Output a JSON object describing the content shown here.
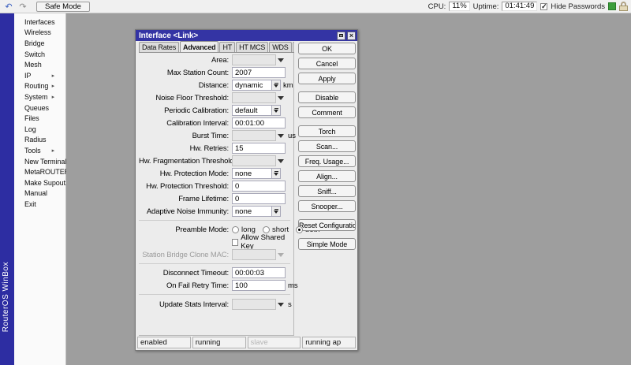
{
  "colors": {
    "titlebar_blue": "#3434a4",
    "brand_strip_blue": "#2d2da2",
    "canvas_gray": "#9e9e9e",
    "status_icon_green": "#3c9e3c"
  },
  "icons": {
    "undo": "↶",
    "redo": "↷",
    "close": "×",
    "submenu_arrow": "▸",
    "check": "✓"
  },
  "toolbar": {
    "safe_mode_label": "Safe Mode",
    "cpu_label": "CPU:",
    "cpu_value": "11%",
    "uptime_label": "Uptime:",
    "uptime_value": "01:41:49",
    "hide_passwords_label": "Hide Passwords",
    "hide_passwords_checked": true
  },
  "sidebar": {
    "brand": "RouterOS WinBox",
    "items": [
      {
        "label": "Interfaces",
        "submenu": false
      },
      {
        "label": "Wireless",
        "submenu": false
      },
      {
        "label": "Bridge",
        "submenu": false
      },
      {
        "label": "Switch",
        "submenu": false
      },
      {
        "label": "Mesh",
        "submenu": false
      },
      {
        "label": "IP",
        "submenu": true
      },
      {
        "label": "Routing",
        "submenu": true
      },
      {
        "label": "System",
        "submenu": true
      },
      {
        "label": "Queues",
        "submenu": false
      },
      {
        "label": "Files",
        "submenu": false
      },
      {
        "label": "Log",
        "submenu": false
      },
      {
        "label": "Radius",
        "submenu": false
      },
      {
        "label": "Tools",
        "submenu": true
      },
      {
        "label": "New Terminal",
        "submenu": false
      },
      {
        "label": "MetaROUTER",
        "submenu": false
      },
      {
        "label": "Make Supout.rif",
        "submenu": false
      },
      {
        "label": "Manual",
        "submenu": false
      },
      {
        "label": "Exit",
        "submenu": false
      }
    ]
  },
  "dialog": {
    "title": "Interface <Link>",
    "tabs": [
      "Data Rates",
      "Advanced",
      "HT",
      "HT MCS",
      "WDS",
      "..."
    ],
    "active_tab": "Advanced",
    "form": {
      "area": {
        "label": "Area:",
        "value": ""
      },
      "max_station_count": {
        "label": "Max Station Count:",
        "value": "2007"
      },
      "distance": {
        "label": "Distance:",
        "value": "dynamic",
        "unit": "km"
      },
      "noise_floor_threshold": {
        "label": "Noise Floor Threshold:",
        "value": ""
      },
      "periodic_calibration": {
        "label": "Periodic Calibration:",
        "value": "default"
      },
      "calibration_interval": {
        "label": "Calibration Interval:",
        "value": "00:01:00"
      },
      "burst_time": {
        "label": "Burst Time:",
        "value": "",
        "unit": "us"
      },
      "hw_retries": {
        "label": "Hw. Retries:",
        "value": "15"
      },
      "hw_fragmentation_threshold": {
        "label": "Hw. Fragmentation Threshold:",
        "value": ""
      },
      "hw_protection_mode": {
        "label": "Hw. Protection Mode:",
        "value": "none"
      },
      "hw_protection_threshold": {
        "label": "Hw. Protection Threshold:",
        "value": "0"
      },
      "frame_lifetime": {
        "label": "Frame Lifetime:",
        "value": "0"
      },
      "adaptive_noise_immunity": {
        "label": "Adaptive Noise Immunity:",
        "value": "none"
      },
      "preamble_mode": {
        "label": "Preamble Mode:",
        "options": [
          "long",
          "short",
          "both"
        ],
        "selected": "both"
      },
      "allow_shared_key": {
        "label": "Allow Shared Key",
        "checked": false
      },
      "station_bridge_clone_mac": {
        "label": "Station Bridge Clone MAC:",
        "value": "",
        "disabled": true
      },
      "disconnect_timeout": {
        "label": "Disconnect Timeout:",
        "value": "00:00:03"
      },
      "on_fail_retry_time": {
        "label": "On Fail Retry Time:",
        "value": "100",
        "unit": "ms"
      },
      "update_stats_interval": {
        "label": "Update Stats Interval:",
        "value": "",
        "unit": "s"
      }
    },
    "buttons": [
      "OK",
      "Cancel",
      "Apply",
      "Disable",
      "Comment",
      "Torch",
      "Scan...",
      "Freq. Usage...",
      "Align...",
      "Sniff...",
      "Snooper...",
      "Reset Configuration",
      "Simple Mode"
    ],
    "status_cells": [
      {
        "label": "enabled",
        "disabled": false
      },
      {
        "label": "running",
        "disabled": false
      },
      {
        "label": "slave",
        "disabled": true
      },
      {
        "label": "running ap",
        "disabled": false
      }
    ]
  }
}
